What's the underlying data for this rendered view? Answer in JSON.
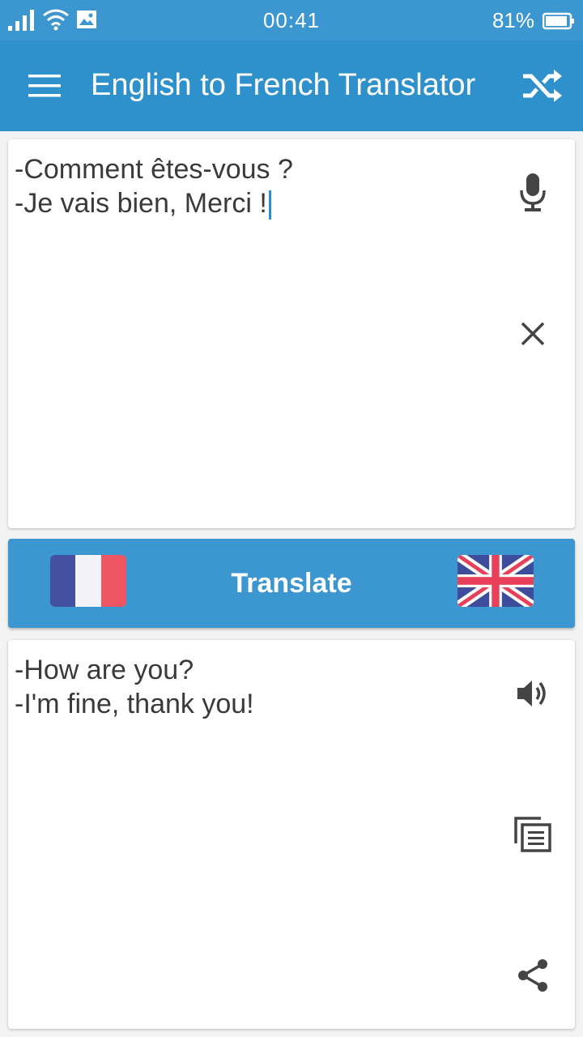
{
  "status_bar": {
    "time": "00:41",
    "battery": "81%"
  },
  "app_bar": {
    "title": "English to French Translator"
  },
  "input": {
    "text": "-Comment êtes-vous ?\n-Je vais bien, Merci !"
  },
  "translate_button": {
    "label": "Translate"
  },
  "output": {
    "text": "-How are you?\n-I'm fine, thank you!"
  },
  "colors": {
    "primary": "#2f91cc",
    "status": "#3c96cf",
    "text": "#3a3a3a",
    "icon": "#444444"
  },
  "icons": [
    "signal-icon",
    "wifi-icon",
    "image-icon",
    "battery-icon",
    "menu-icon",
    "shuffle-icon",
    "microphone-icon",
    "clear-icon",
    "french-flag-icon",
    "uk-flag-icon",
    "speaker-icon",
    "copy-icon",
    "share-icon"
  ]
}
